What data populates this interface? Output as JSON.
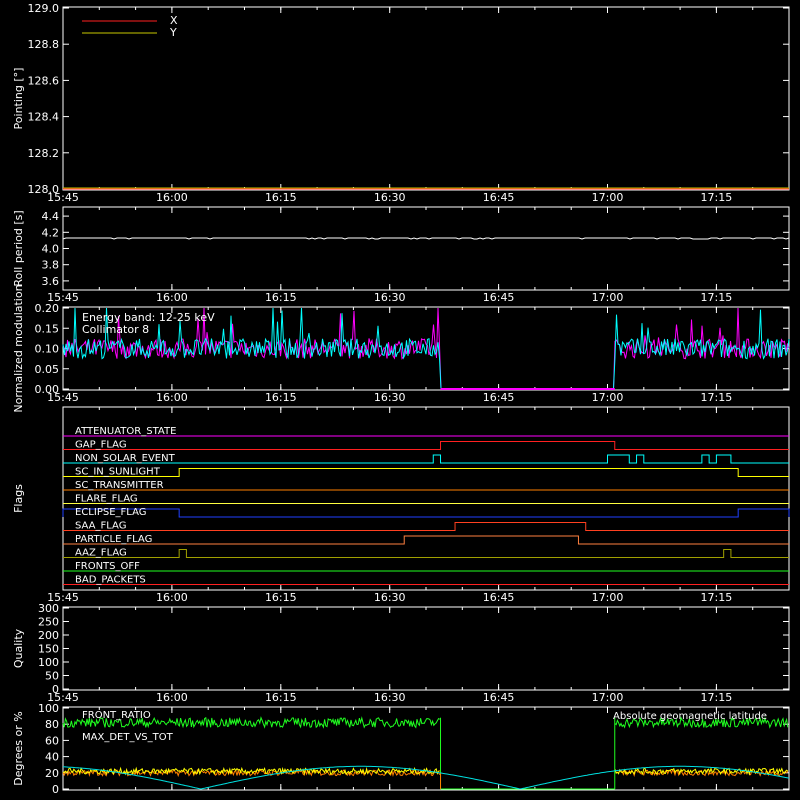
{
  "chart_data": [
    {
      "type": "line",
      "ylabel": "Pointing [°]",
      "ylim": [
        128.0,
        129.0
      ],
      "yticks": [
        "128.0",
        "128.2",
        "128.4",
        "128.6",
        "128.8",
        "129.0"
      ],
      "xticks": [
        "15:45",
        "16:00",
        "16:15",
        "16:30",
        "16:45",
        "17:00",
        "17:15"
      ],
      "xlim_minutes": [
        945,
        1045
      ],
      "series": [
        {
          "name": "X",
          "color": "#ff2020",
          "values": [
            128.0,
            128.0
          ]
        },
        {
          "name": "Y",
          "color": "#c8c800",
          "values": [
            128.0,
            128.0
          ]
        }
      ]
    },
    {
      "type": "line",
      "ylabel": "Roll period [s]",
      "ylim": [
        3.5,
        4.5
      ],
      "yticks": [
        "3.6",
        "3.8",
        "4.0",
        "4.2",
        "4.4"
      ],
      "xticks": [
        "15:45",
        "16:00",
        "16:15",
        "16:30",
        "16:45",
        "17:00",
        "17:15"
      ],
      "series": [
        {
          "color": "#ffffff",
          "value": 4.13
        }
      ]
    },
    {
      "type": "line",
      "ylabel": "Normalized modulation",
      "ylim": [
        0.0,
        0.2
      ],
      "yticks": [
        "0.00",
        "0.05",
        "0.10",
        "0.15",
        "0.20"
      ],
      "xticks": [
        "15:45",
        "16:00",
        "16:15",
        "16:30",
        "16:45",
        "17:00",
        "17:15"
      ],
      "annotation": "Energy band: 12-25 keV",
      "gap": {
        "from": "16:37",
        "to": "17:01"
      },
      "series": [
        {
          "name": "Collimator 8",
          "color": "#00ffff",
          "typical": 0.1
        },
        {
          "color": "#ff00ff",
          "typical": 0.1
        }
      ]
    },
    {
      "type": "line",
      "ylabel": "Flags",
      "xticks": [
        "15:45",
        "16:00",
        "16:15",
        "16:30",
        "16:45",
        "17:00",
        "17:15"
      ],
      "flags": [
        {
          "name": "ATTENUATOR_STATE",
          "color": "#ff00ff",
          "on": []
        },
        {
          "name": "GAP_FLAG",
          "color": "#ff2020",
          "on": [
            [
              "16:37",
              "17:01"
            ]
          ]
        },
        {
          "name": "NON_SOLAR_EVENT",
          "color": "#00ffff",
          "on": [
            [
              "16:36",
              "16:37"
            ],
            [
              "17:00",
              "17:03"
            ],
            [
              "17:04",
              "17:05"
            ],
            [
              "17:13",
              "17:14"
            ],
            [
              "17:15",
              "17:17"
            ]
          ]
        },
        {
          "name": "SC_IN_SUNLIGHT",
          "color": "#ffff00",
          "on": [
            [
              "16:01",
              "17:18"
            ]
          ]
        },
        {
          "name": "SC_TRANSMITTER",
          "color": "#ff8000",
          "on": []
        },
        {
          "name": "FLARE_FLAG",
          "color": "#ffff40",
          "on": []
        },
        {
          "name": "ECLIPSE_FLAG",
          "color": "#2040ff",
          "on": [
            [
              "15:45",
              "16:01"
            ],
            [
              "17:18",
              "17:25"
            ]
          ]
        },
        {
          "name": "SAA_FLAG",
          "color": "#ff4020",
          "on": [
            [
              "16:39",
              "16:57"
            ]
          ]
        },
        {
          "name": "PARTICLE_FLAG",
          "color": "#ff8040",
          "on": [
            [
              "16:32",
              "16:56"
            ]
          ]
        },
        {
          "name": "AAZ_FLAG",
          "color": "#a0a000",
          "on": [
            [
              "16:01",
              "16:02"
            ],
            [
              "17:16",
              "17:17"
            ]
          ]
        },
        {
          "name": "FRONTS_OFF",
          "color": "#20ff20",
          "on": []
        },
        {
          "name": "BAD_PACKETS",
          "color": "#ff2020",
          "on": []
        }
      ]
    },
    {
      "type": "line",
      "ylabel": "Quality",
      "ylim": [
        0,
        300
      ],
      "yticks": [
        "0",
        "50",
        "100",
        "150",
        "200",
        "250",
        "300"
      ],
      "xticks": [
        "15:45",
        "16:00",
        "16:15",
        "16:30",
        "16:45",
        "17:00",
        "17:15"
      ],
      "series": []
    },
    {
      "type": "line",
      "ylabel": "Degrees or %",
      "ylim": [
        0,
        100
      ],
      "yticks": [
        "0",
        "20",
        "40",
        "60",
        "80",
        "100"
      ],
      "xticks": [
        "15:45",
        "16:00",
        "16:15",
        "16:30",
        "16:45",
        "17:00",
        "17:15"
      ],
      "gap": {
        "from": "16:37",
        "to": "17:01"
      },
      "series": [
        {
          "name": "FRONT_RATIO",
          "color": "#20ff20",
          "typical": 82
        },
        {
          "name": "MAX_DET_VS_TOT",
          "color": "#ff8000",
          "typical": 20
        },
        {
          "color": "#ffff00",
          "typical": 22
        },
        {
          "name": "Absolute geomagnetic latitude",
          "color": "#00e0e0",
          "min": 0,
          "max": 28
        }
      ]
    }
  ]
}
